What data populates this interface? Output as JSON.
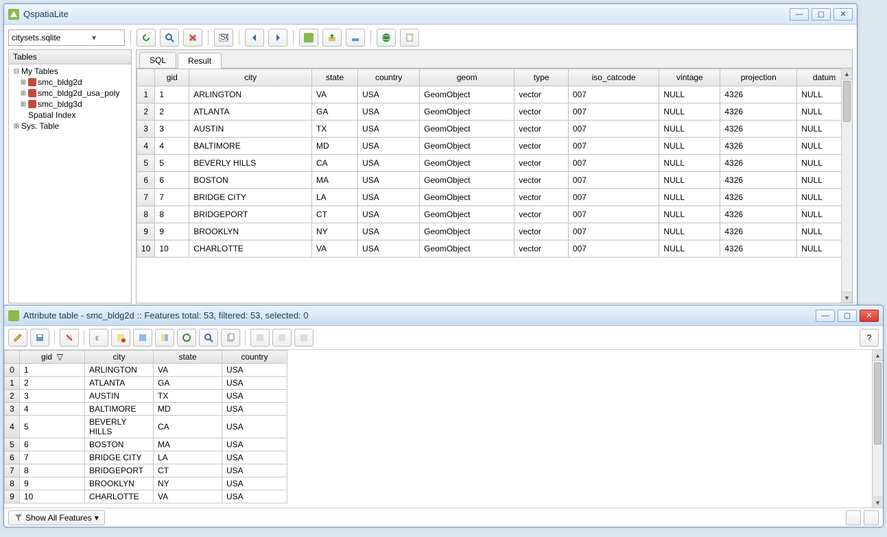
{
  "qsl": {
    "title": "QspatiaLite",
    "database_combo": "citysets.sqlite",
    "sidebar_header": "Tables",
    "tree": {
      "root": "My Tables",
      "items": [
        "smc_bldg2d",
        "smc_bldg2d_usa_poly",
        "smc_bldg3d"
      ],
      "extra": [
        "Spatial Index",
        "Sys. Table"
      ]
    },
    "tabs": {
      "sql": "SQL",
      "result": "Result",
      "active": "Result"
    },
    "columns": [
      "gid",
      "city",
      "state",
      "country",
      "geom",
      "type",
      "iso_catcode",
      "vintage",
      "projection",
      "datum"
    ],
    "rows": [
      {
        "n": "1",
        "gid": "1",
        "city": "ARLINGTON",
        "state": "VA",
        "country": "USA",
        "geom": "GeomObject",
        "type": "vector",
        "iso_catcode": "007",
        "vintage": "NULL",
        "projection": "4326",
        "datum": "NULL"
      },
      {
        "n": "2",
        "gid": "2",
        "city": "ATLANTA",
        "state": "GA",
        "country": "USA",
        "geom": "GeomObject",
        "type": "vector",
        "iso_catcode": "007",
        "vintage": "NULL",
        "projection": "4326",
        "datum": "NULL"
      },
      {
        "n": "3",
        "gid": "3",
        "city": "AUSTIN",
        "state": "TX",
        "country": "USA",
        "geom": "GeomObject",
        "type": "vector",
        "iso_catcode": "007",
        "vintage": "NULL",
        "projection": "4326",
        "datum": "NULL"
      },
      {
        "n": "4",
        "gid": "4",
        "city": "BALTIMORE",
        "state": "MD",
        "country": "USA",
        "geom": "GeomObject",
        "type": "vector",
        "iso_catcode": "007",
        "vintage": "NULL",
        "projection": "4326",
        "datum": "NULL"
      },
      {
        "n": "5",
        "gid": "5",
        "city": "BEVERLY HILLS",
        "state": "CA",
        "country": "USA",
        "geom": "GeomObject",
        "type": "vector",
        "iso_catcode": "007",
        "vintage": "NULL",
        "projection": "4326",
        "datum": "NULL"
      },
      {
        "n": "6",
        "gid": "6",
        "city": "BOSTON",
        "state": "MA",
        "country": "USA",
        "geom": "GeomObject",
        "type": "vector",
        "iso_catcode": "007",
        "vintage": "NULL",
        "projection": "4326",
        "datum": "NULL"
      },
      {
        "n": "7",
        "gid": "7",
        "city": "BRIDGE CITY",
        "state": "LA",
        "country": "USA",
        "geom": "GeomObject",
        "type": "vector",
        "iso_catcode": "007",
        "vintage": "NULL",
        "projection": "4326",
        "datum": "NULL"
      },
      {
        "n": "8",
        "gid": "8",
        "city": "BRIDGEPORT",
        "state": "CT",
        "country": "USA",
        "geom": "GeomObject",
        "type": "vector",
        "iso_catcode": "007",
        "vintage": "NULL",
        "projection": "4326",
        "datum": "NULL"
      },
      {
        "n": "9",
        "gid": "9",
        "city": "BROOKLYN",
        "state": "NY",
        "country": "USA",
        "geom": "GeomObject",
        "type": "vector",
        "iso_catcode": "007",
        "vintage": "NULL",
        "projection": "4326",
        "datum": "NULL"
      },
      {
        "n": "10",
        "gid": "10",
        "city": "CHARLOTTE",
        "state": "VA",
        "country": "USA",
        "geom": "GeomObject",
        "type": "vector",
        "iso_catcode": "007",
        "vintage": "NULL",
        "projection": "4326",
        "datum": "NULL"
      }
    ]
  },
  "attr": {
    "title": "Attribute table - smc_bldg2d :: Features total: 53, filtered: 53, selected: 0",
    "columns": [
      "gid",
      "city",
      "state",
      "country"
    ],
    "rows": [
      {
        "n": "0",
        "gid": "1",
        "city": "ARLINGTON",
        "state": "VA",
        "country": "USA"
      },
      {
        "n": "1",
        "gid": "2",
        "city": "ATLANTA",
        "state": "GA",
        "country": "USA"
      },
      {
        "n": "2",
        "gid": "3",
        "city": "AUSTIN",
        "state": "TX",
        "country": "USA"
      },
      {
        "n": "3",
        "gid": "4",
        "city": "BALTIMORE",
        "state": "MD",
        "country": "USA"
      },
      {
        "n": "4",
        "gid": "5",
        "city": "BEVERLY HILLS",
        "state": "CA",
        "country": "USA"
      },
      {
        "n": "5",
        "gid": "6",
        "city": "BOSTON",
        "state": "MA",
        "country": "USA"
      },
      {
        "n": "6",
        "gid": "7",
        "city": "BRIDGE CITY",
        "state": "LA",
        "country": "USA"
      },
      {
        "n": "7",
        "gid": "8",
        "city": "BRIDGEPORT",
        "state": "CT",
        "country": "USA"
      },
      {
        "n": "8",
        "gid": "9",
        "city": "BROOKLYN",
        "state": "NY",
        "country": "USA"
      },
      {
        "n": "9",
        "gid": "10",
        "city": "CHARLOTTE",
        "state": "VA",
        "country": "USA"
      }
    ],
    "footer_label": "Show All Features"
  }
}
